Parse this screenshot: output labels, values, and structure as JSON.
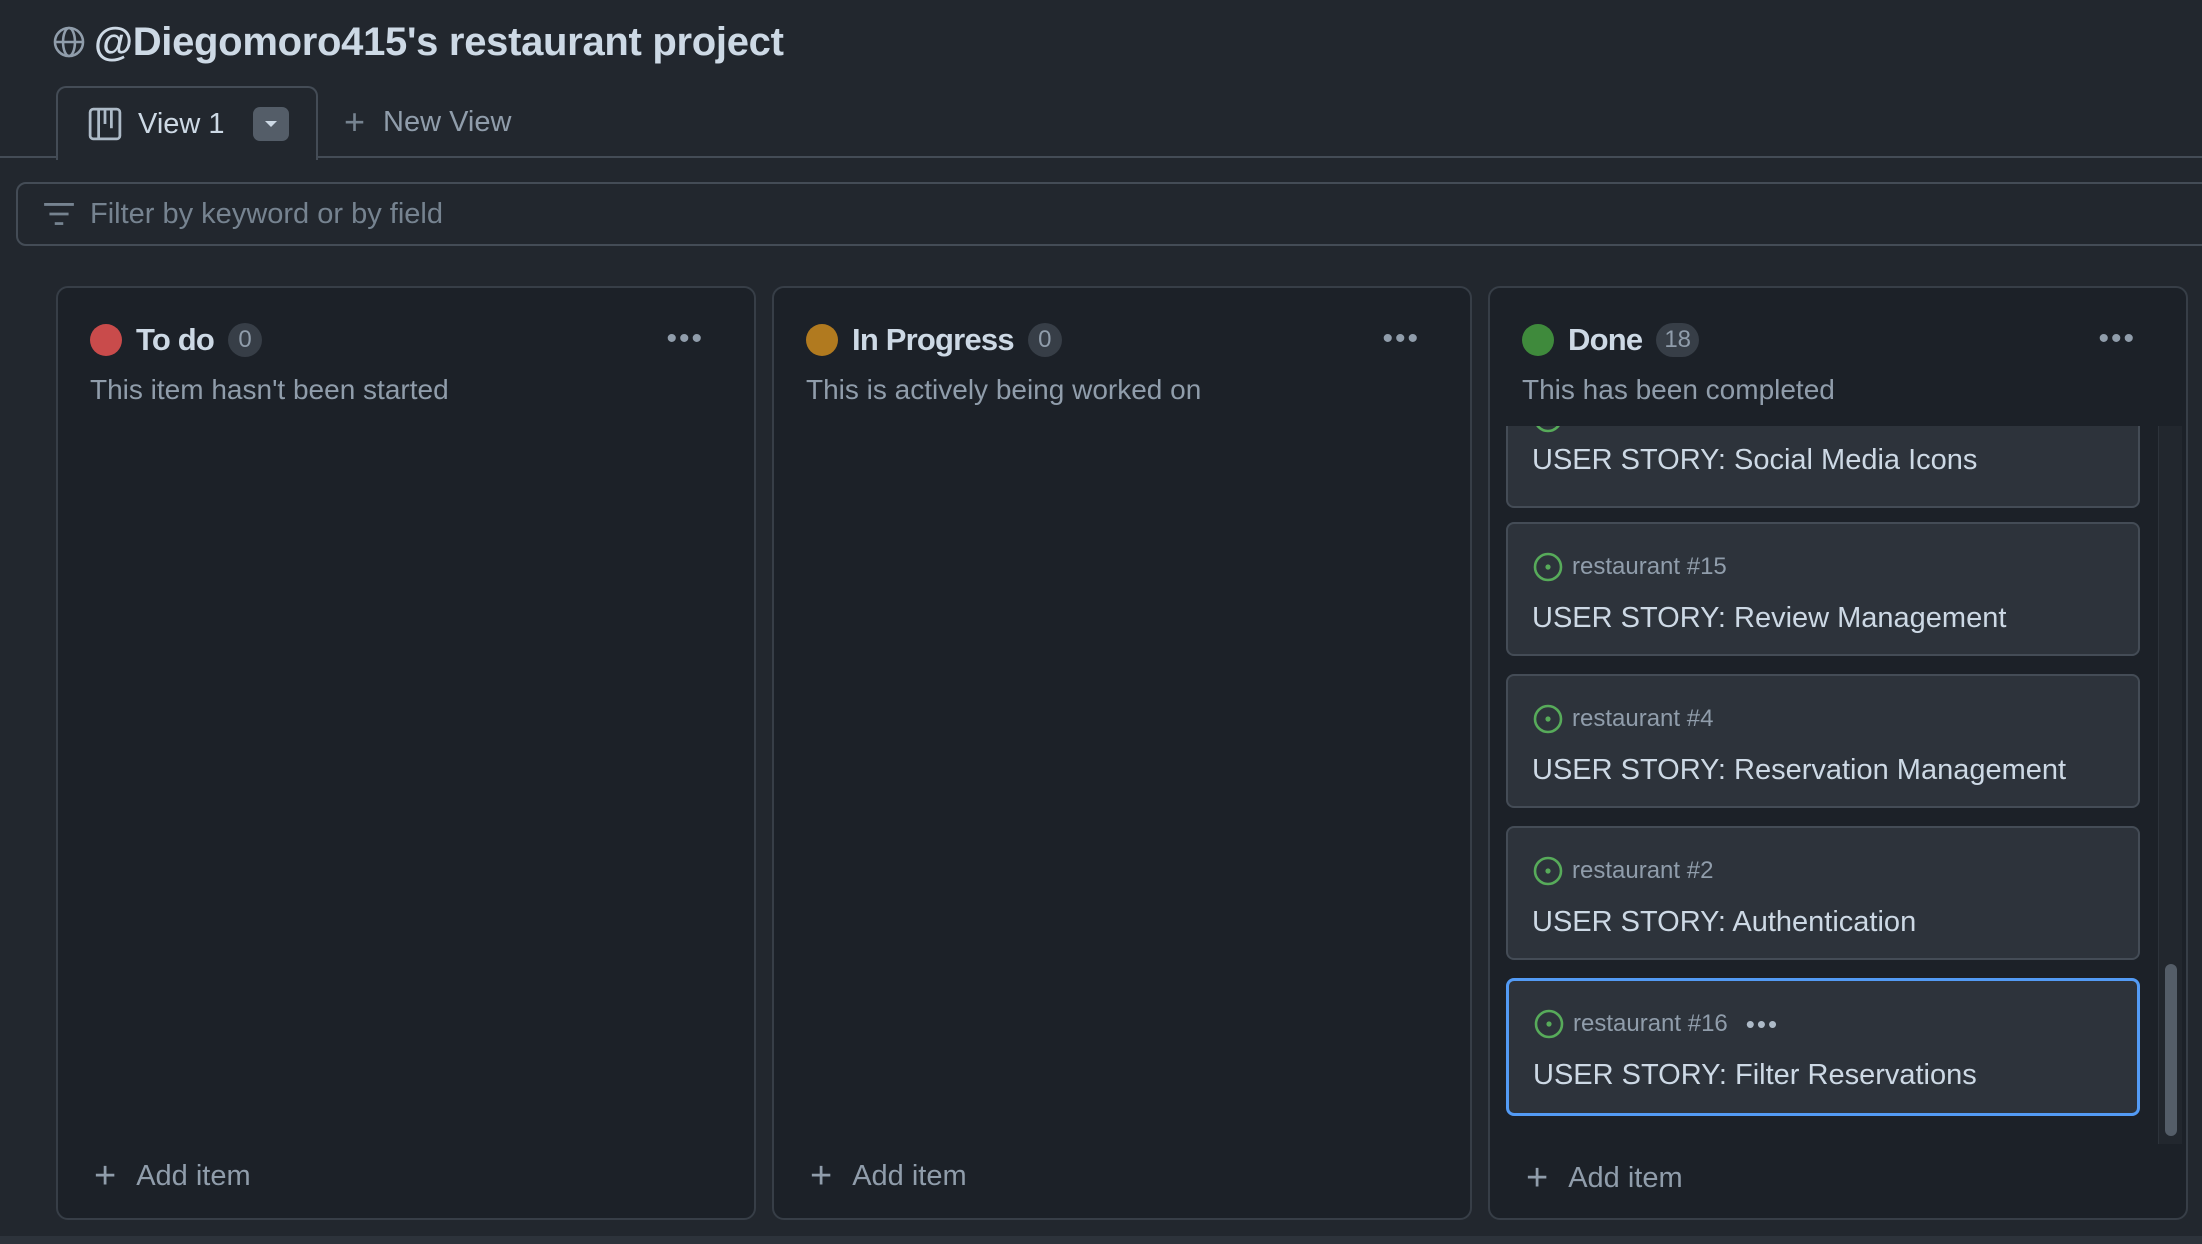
{
  "project": {
    "title": "@Diegomoro415's restaurant project",
    "icon": "globe-icon"
  },
  "tabs": {
    "active_label": "View 1",
    "active_icon": "board-icon",
    "new_view_label": "New View"
  },
  "filter": {
    "placeholder": "Filter by keyword or by field"
  },
  "columns": [
    {
      "name": "To do",
      "count": "0",
      "description": "This item hasn't been started",
      "color": "#c94b4b",
      "add_label": "Add item",
      "cards": []
    },
    {
      "name": "In Progress",
      "count": "0",
      "description": "This is actively being worked on",
      "color": "#b17a1f",
      "add_label": "Add item",
      "cards": []
    },
    {
      "name": "Done",
      "count": "18",
      "description": "This has been completed",
      "color": "#3f8a3c",
      "add_label": "Add item",
      "cards": [
        {
          "ref": "",
          "title": "USER STORY: Social Media Icons"
        },
        {
          "ref": "restaurant #15",
          "title": "USER STORY: Review Management"
        },
        {
          "ref": "restaurant #4",
          "title": "USER STORY: Reservation Management"
        },
        {
          "ref": "restaurant #2",
          "title": "USER STORY: Authentication"
        },
        {
          "ref": "restaurant #16",
          "title": "USER STORY: Filter Reservations",
          "selected": true
        }
      ]
    }
  ],
  "colors": {
    "background": "#22272e",
    "column_bg": "#1c2128",
    "card_bg": "#2d333b",
    "accent_blue": "#539bf5",
    "open_issue_green": "#57ab5a"
  }
}
